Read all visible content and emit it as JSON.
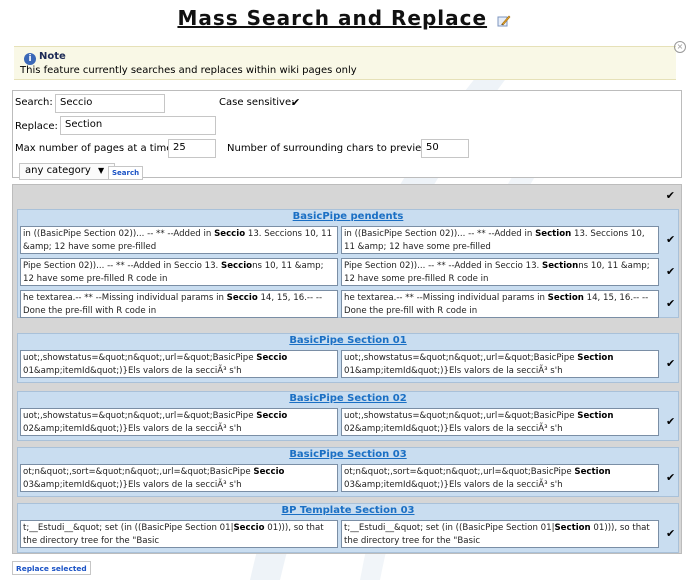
{
  "title": "Mass Search and Replace",
  "note": {
    "heading": "Note",
    "text": "This feature currently searches and replaces within wiki pages only"
  },
  "form": {
    "search_label": "Search:",
    "search_value": "Seccio",
    "case_label": "Case sensitive:",
    "case_checked": "✔",
    "replace_label": "Replace:",
    "replace_value": "Section",
    "max_label": "Max number of pages at a time:",
    "max_value": "25",
    "chars_label": "Number of surrounding chars to preview:",
    "chars_value": "50",
    "category_value": "any category",
    "category_arrow": "▼",
    "search_button": "Search"
  },
  "results": {
    "select_all_check": "✔",
    "row_check": "✔",
    "groups": [
      {
        "title": "BasicPipe pendents",
        "rows": [
          {
            "left": {
              "pre": "in ((BasicPipe Section 02))... -- ** --Added in ",
              "hl": "Seccio",
              "post": " 13. Seccions 10, 11 &amp; 12 have some pre-filled"
            },
            "right": {
              "pre": "in ((BasicPipe Section 02))... -- ** --Added in ",
              "hl": "Section",
              "post": " 13. Seccions 10, 11 &amp; 12 have some pre-filled"
            }
          },
          {
            "left": {
              "pre": "Pipe Section 02))... -- ** --Added in Seccio 13. ",
              "hl": "Seccio",
              "post": "ns 10, 11 &amp; 12 have some pre-filled R code in"
            },
            "right": {
              "pre": "Pipe Section 02))... -- ** --Added in Seccio 13. ",
              "hl": "Section",
              "post": "ns 10, 11 &amp; 12 have some pre-filled R code in"
            }
          },
          {
            "left": {
              "pre": "he textarea.-- ** --Missing individual params in ",
              "hl": "Seccio",
              "post": " 14, 15, 16.-- --Done the pre-fill with R code in"
            },
            "right": {
              "pre": "he textarea.-- ** --Missing individual params in ",
              "hl": "Section",
              "post": " 14, 15, 16.-- --Done the pre-fill with R code in"
            }
          }
        ]
      },
      {
        "title": "BasicPipe Section 01",
        "rows": [
          {
            "left": {
              "pre": "uot;,showstatus=&quot;n&quot;,url=&quot;BasicPipe ",
              "hl": "Seccio",
              "post": " 01&amp;itemId&quot;)}Els valors de la secciÃ³ s'h"
            },
            "right": {
              "pre": "uot;,showstatus=&quot;n&quot;,url=&quot;BasicPipe ",
              "hl": "Section",
              "post": " 01&amp;itemId&quot;)}Els valors de la secciÃ³ s'h"
            }
          }
        ]
      },
      {
        "title": "BasicPipe Section 02",
        "rows": [
          {
            "left": {
              "pre": "uot;,showstatus=&quot;n&quot;,url=&quot;BasicPipe ",
              "hl": "Seccio",
              "post": " 02&amp;itemId&quot;)}Els valors de la secciÃ³ s'h"
            },
            "right": {
              "pre": "uot;,showstatus=&quot;n&quot;,url=&quot;BasicPipe ",
              "hl": "Section",
              "post": " 02&amp;itemId&quot;)}Els valors de la secciÃ³ s'h"
            }
          }
        ]
      },
      {
        "title": "BasicPipe Section 03",
        "rows": [
          {
            "left": {
              "pre": "ot;n&quot;,sort=&quot;n&quot;,url=&quot;BasicPipe ",
              "hl": "Seccio",
              "post": " 03&amp;itemId&quot;)}Els valors de la secciÃ³ s'h"
            },
            "right": {
              "pre": "ot;n&quot;,sort=&quot;n&quot;,url=&quot;BasicPipe ",
              "hl": "Section",
              "post": " 03&amp;itemId&quot;)}Els valors de la secciÃ³ s'h"
            }
          }
        ]
      },
      {
        "title": "BP Template Section 03",
        "rows": [
          {
            "left": {
              "pre": "t;__Estudi__&quot; set (in ((BasicPipe Section 01|",
              "hl": "Seccio",
              "post": " 01))), so that the directory tree for the \"Basic"
            },
            "right": {
              "pre": "t;__Estudi__&quot; set (in ((BasicPipe Section 01|",
              "hl": "Section",
              "post": " 01))), so that the directory tree for the \"Basic"
            }
          }
        ]
      }
    ]
  },
  "replace_button": "Replace selected",
  "colors": {
    "link": "#1a6fc4",
    "group_bg": "#c9ddf0",
    "note_bg": "#f9f8e6"
  }
}
